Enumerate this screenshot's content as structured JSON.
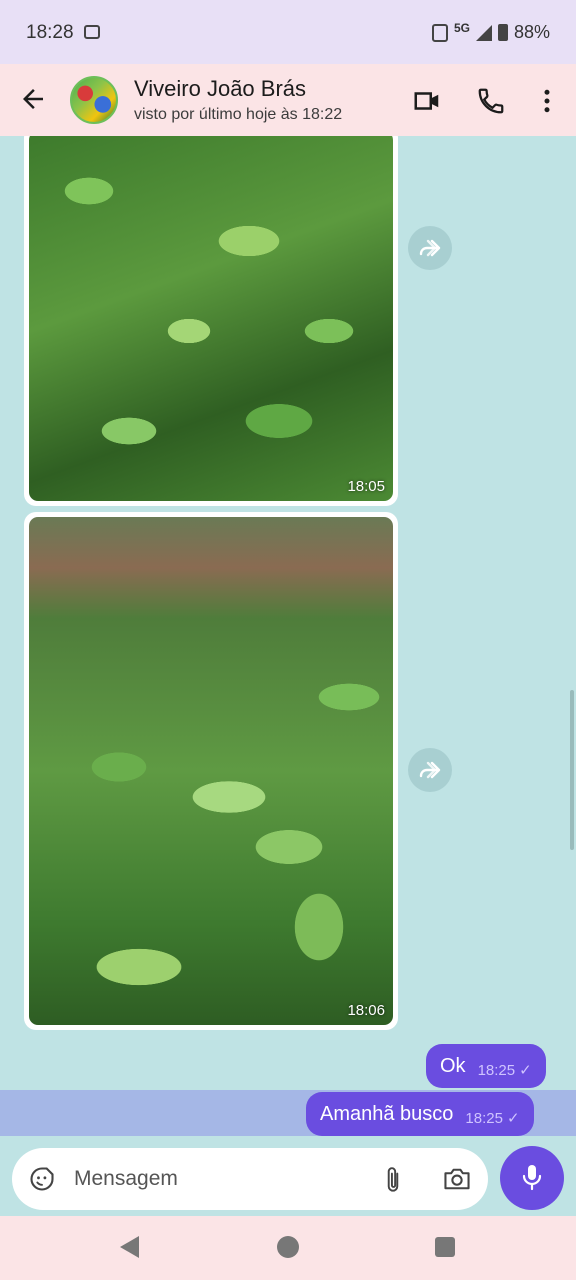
{
  "status_bar": {
    "time": "18:28",
    "network": "5G",
    "battery": "88%"
  },
  "header": {
    "contact_name": "Viveiro João Brás",
    "last_seen": "visto por último hoje às 18:22"
  },
  "messages": [
    {
      "type": "image",
      "direction": "incoming",
      "time": "18:05"
    },
    {
      "type": "image",
      "direction": "incoming",
      "time": "18:06"
    },
    {
      "type": "text",
      "direction": "outgoing",
      "text": "Ok",
      "time": "18:25"
    },
    {
      "type": "text",
      "direction": "outgoing",
      "text": "Amanhã busco",
      "time": "18:25"
    }
  ],
  "composer": {
    "placeholder": "Mensagem"
  },
  "icons": {
    "back": "arrow-back-icon",
    "video": "video-call-icon",
    "phone": "phone-icon",
    "menu": "more-vertical-icon",
    "forward": "forward-icon",
    "emoji": "sticker-icon",
    "attach": "paperclip-icon",
    "camera": "camera-icon",
    "mic": "mic-icon"
  },
  "colors": {
    "accent": "#6a4de0",
    "chat_bg": "#bfe3e4",
    "header_bg": "#fbe4e6"
  }
}
